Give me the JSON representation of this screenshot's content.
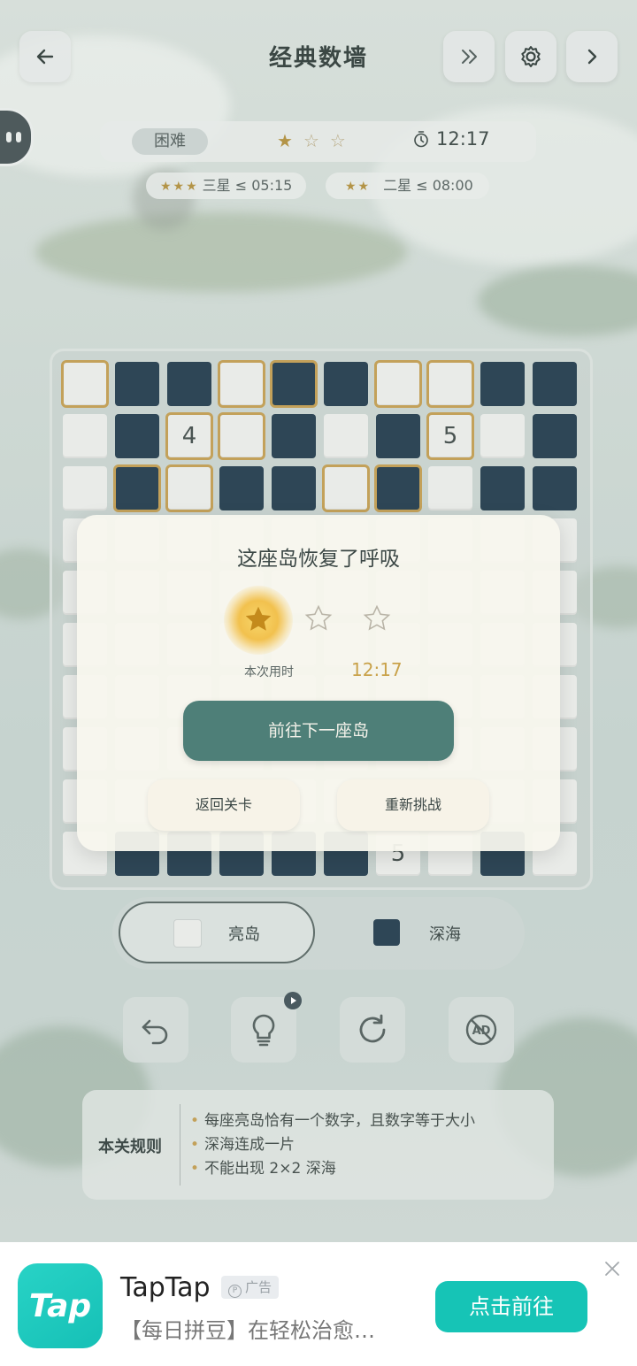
{
  "header": {
    "title": "经典数墙",
    "back_icon": "back-arrow-icon",
    "skip_icon": "double-chevron-icon",
    "settings_icon": "gear-icon",
    "next_icon": "chevron-right-icon"
  },
  "status": {
    "difficulty": "困难",
    "stars_earned": 1,
    "stars_total": 3,
    "timer": "12:17",
    "targets": [
      {
        "stars": "★★★",
        "text": "三星 ≤ 05:15"
      },
      {
        "stars": "★★",
        "text": "二星 ≤ 08:00"
      }
    ]
  },
  "board": {
    "size": 10,
    "cells_visible_rows": [
      [
        "L",
        "D",
        "D",
        "L",
        "D",
        "D",
        "L",
        "L",
        "D",
        "D"
      ],
      [
        "L",
        "D",
        "4",
        "L",
        "D",
        "L",
        "D",
        "5",
        "L",
        "D"
      ],
      [
        "L",
        "D",
        "L",
        "D",
        "D",
        "L",
        "D",
        "L",
        "D",
        "D"
      ]
    ],
    "bottom_numbers": [
      "5"
    ]
  },
  "modal": {
    "title": "这座岛恢复了呼吸",
    "stars_earned": 1,
    "time_label": "本次用时",
    "time_value": "12:17",
    "primary_button": "前往下一座岛",
    "back_button": "返回关卡",
    "retry_button": "重新挑战"
  },
  "mode": {
    "options": [
      {
        "label": "亮岛",
        "color": "#e9ebe8",
        "active": true
      },
      {
        "label": "深海",
        "color": "#2e4656",
        "active": false
      }
    ]
  },
  "tools": [
    "undo-icon",
    "hint-bulb-icon",
    "restart-icon",
    "no-ads-icon"
  ],
  "rules": {
    "title": "本关规则",
    "items": [
      "每座亮岛恰有一个数字，且数字等于大小",
      "深海连成一片",
      "不能出现 2×2 深海"
    ]
  },
  "ad": {
    "logo_text": "Tap",
    "name": "TapTap",
    "tag": "广告",
    "description": "【每日拼豆】在轻松治愈…",
    "cta": "点击前往",
    "colors": {
      "brand": "#16c4b6"
    }
  },
  "colors": {
    "accent": "#4e7f78",
    "gold": "#c3a15a",
    "deep_sea": "#2e4656",
    "island": "#e9ebe8"
  }
}
